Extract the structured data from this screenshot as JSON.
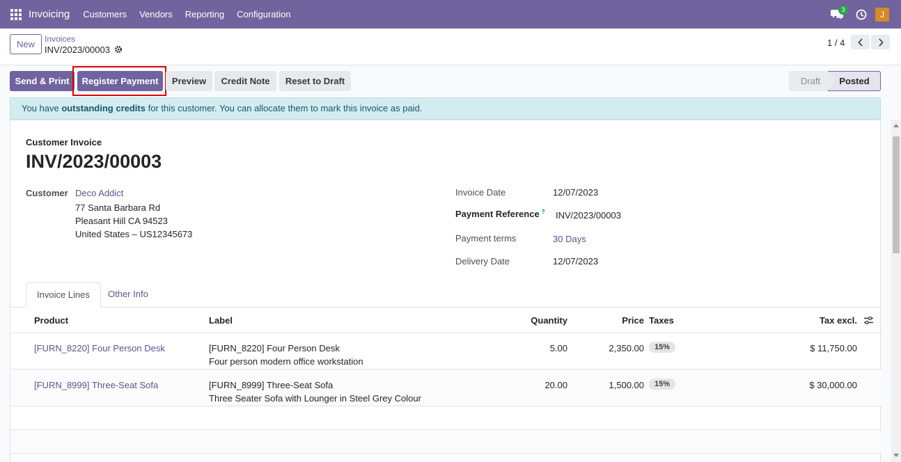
{
  "navbar": {
    "brand": "Invoicing",
    "menu": [
      "Customers",
      "Vendors",
      "Reporting",
      "Configuration"
    ],
    "chat_count": "3",
    "avatar_initial": "J"
  },
  "control": {
    "new_label": "New",
    "breadcrumb_parent": "Invoices",
    "breadcrumb_current": "INV/2023/00003",
    "pager": "1 / 4"
  },
  "actions": {
    "send_print": "Send & Print",
    "register_payment": "Register Payment",
    "preview": "Preview",
    "credit_note": "Credit Note",
    "reset_to_draft": "Reset to Draft"
  },
  "status": {
    "draft": "Draft",
    "posted": "Posted"
  },
  "alert": {
    "prefix": "You have ",
    "bold": "outstanding credits",
    "suffix": " for this customer. You can allocate them to mark this invoice as paid."
  },
  "invoice": {
    "type": "Customer Invoice",
    "name": "INV/2023/00003",
    "customer_label": "Customer",
    "customer_name": "Deco Addict",
    "address": [
      "77 Santa Barbara Rd",
      "Pleasant Hill CA 94523",
      "United States – US12345673"
    ],
    "invoice_date_label": "Invoice Date",
    "invoice_date": "12/07/2023",
    "payment_ref_label": "Payment Reference",
    "payment_ref_help": "?",
    "payment_ref": "INV/2023/00003",
    "payment_terms_label": "Payment terms",
    "payment_terms": "30 Days",
    "delivery_date_label": "Delivery Date",
    "delivery_date": "12/07/2023"
  },
  "tabs": {
    "lines": "Invoice Lines",
    "other": "Other Info"
  },
  "table": {
    "headers": {
      "product": "Product",
      "label": "Label",
      "quantity": "Quantity",
      "price": "Price",
      "taxes": "Taxes",
      "tax_excl": "Tax excl."
    },
    "rows": [
      {
        "product": "[FURN_8220] Four Person Desk",
        "label_line1": "[FURN_8220] Four Person Desk",
        "label_line2": "Four person modern office workstation",
        "quantity": "5.00",
        "price": "2,350.00",
        "tax": "15%",
        "subtotal": "$ 11,750.00"
      },
      {
        "product": "[FURN_8999] Three-Seat Sofa",
        "label_line1": "[FURN_8999] Three-Seat Sofa",
        "label_line2": "Three Seater Sofa with Lounger in Steel Grey Colour",
        "quantity": "20.00",
        "price": "1,500.00",
        "tax": "15%",
        "subtotal": "$ 30,000.00"
      }
    ]
  }
}
